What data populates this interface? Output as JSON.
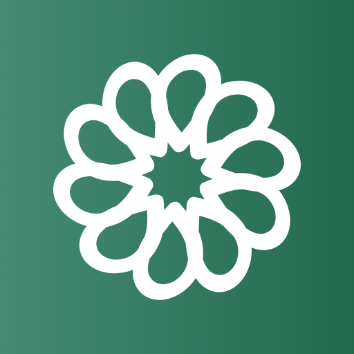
{
  "icon": {
    "name": "flower-logo-icon",
    "background_gradient_start": "#468a73",
    "background_gradient_end": "#226a4f",
    "logo_color": "#ffffff",
    "petal_count": 10
  }
}
